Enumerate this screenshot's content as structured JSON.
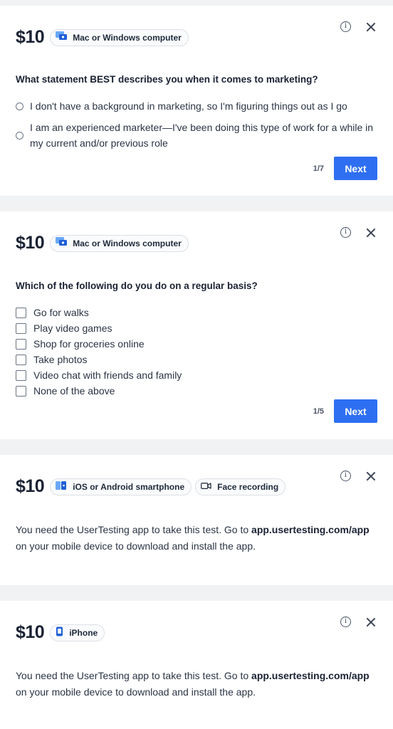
{
  "cards": [
    {
      "price": "$10",
      "chips": [
        {
          "label": "Mac or Windows computer",
          "icon": "computer-icon"
        }
      ],
      "question": "What statement BEST describes you when it comes to marketing?",
      "option_type": "radio",
      "options": [
        "I don't have a background in marketing, so I'm figuring things out as I go",
        "I am an experienced marketer—I've been doing this type of work for a while in my current and/or previous role"
      ],
      "counter": "1/7",
      "next_label": "Next"
    },
    {
      "price": "$10",
      "chips": [
        {
          "label": "Mac or Windows computer",
          "icon": "computer-icon"
        }
      ],
      "question": "Which of the following do you do on a regular basis?",
      "option_type": "checkbox",
      "options": [
        "Go for walks",
        "Play video games",
        "Shop for groceries online",
        "Take photos",
        "Video chat with friends and family",
        "None of the above"
      ],
      "counter": "1/5",
      "next_label": "Next"
    },
    {
      "price": "$10",
      "chips": [
        {
          "label": "iOS or Android smartphone",
          "icon": "smartphone-icon"
        },
        {
          "label": "Face recording",
          "icon": "camera-icon"
        }
      ],
      "message_pre": "You need the UserTesting app to take this test. Go to",
      "message_link": "app.usertesting.com/app",
      "message_post": "on your mobile device to download and install the app."
    },
    {
      "price": "$10",
      "chips": [
        {
          "label": "iPhone",
          "icon": "iphone-icon"
        }
      ],
      "message_pre": "You need the UserTesting app to take this test. Go to",
      "message_link": "app.usertesting.com/app",
      "message_post": "on your mobile device to download and install the app."
    }
  ],
  "colors": {
    "accent": "#2e6ff2",
    "background": "#f1f2f4",
    "card": "#ffffff",
    "text": "#1a2233"
  }
}
